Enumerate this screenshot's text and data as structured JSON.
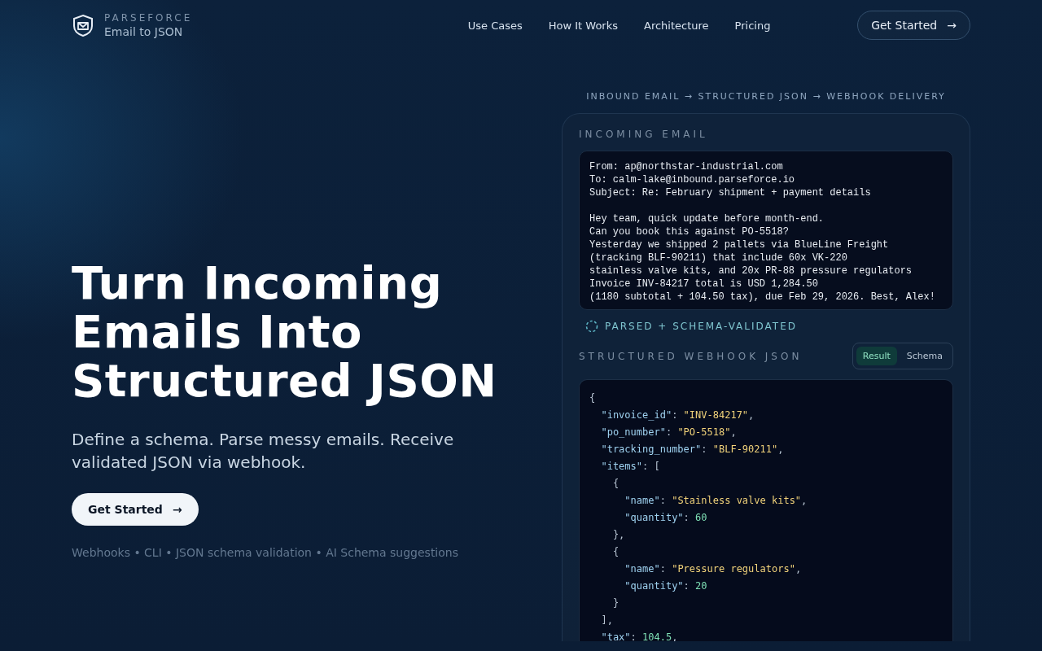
{
  "brand": {
    "name": "PARSEFORCE",
    "tagline": "Email to JSON"
  },
  "nav": [
    "Use Cases",
    "How It Works",
    "Architecture",
    "Pricing"
  ],
  "header_cta": {
    "label": "Get Started",
    "icon": "→"
  },
  "hero": {
    "title": "Turn Incoming Emails Into Structured JSON",
    "subtitle": "Define a schema. Parse messy emails. Receive validated JSON via webhook.",
    "cta": {
      "label": "Get Started",
      "icon": "→"
    },
    "features": "Webhooks • CLI • JSON schema validation • AI Schema suggestions"
  },
  "demo": {
    "caption": "INBOUND EMAIL → STRUCTURED JSON → WEBHOOK DELIVERY",
    "email_heading": "INCOMING EMAIL",
    "email_headers": [
      "From: ap@northstar-industrial.com",
      "To: calm-lake@inbound.parseforce.io",
      "Subject: Re: February shipment + payment details"
    ],
    "email_body": [
      "Hey team, quick update before month-end.",
      "Can you book this against PO-5518?",
      "Yesterday we shipped 2 pallets via BlueLine Freight",
      "(tracking BLF-90211) that include 60x VK-220",
      "stainless valve kits, and 20x PR-88 pressure regulators",
      "Invoice INV-84217 total is USD 1,284.50",
      "(1180 subtotal + 104.50 tax), due Feb 29, 2026. Best, Alex!"
    ],
    "status": "PARSED + SCHEMA-VALIDATED",
    "json_heading": "STRUCTURED WEBHOOK JSON",
    "tabs": [
      {
        "label": "Result",
        "selected": true
      },
      {
        "label": "Schema",
        "selected": false
      }
    ],
    "code_lines": [
      [
        {
          "kind": "punct",
          "text": "{"
        }
      ],
      [
        {
          "kind": "key",
          "text": "  \"invoice_id\""
        },
        {
          "kind": "punct",
          "text": ": "
        },
        {
          "kind": "string",
          "text": "\"INV-84217\""
        },
        {
          "kind": "punct",
          "text": ","
        }
      ],
      [
        {
          "kind": "key",
          "text": "  \"po_number\""
        },
        {
          "kind": "punct",
          "text": ": "
        },
        {
          "kind": "string",
          "text": "\"PO-5518\""
        },
        {
          "kind": "punct",
          "text": ","
        }
      ],
      [
        {
          "kind": "key",
          "text": "  \"tracking_number\""
        },
        {
          "kind": "punct",
          "text": ": "
        },
        {
          "kind": "string",
          "text": "\"BLF-90211\""
        },
        {
          "kind": "punct",
          "text": ","
        }
      ],
      [
        {
          "kind": "key",
          "text": "  \"items\""
        },
        {
          "kind": "punct",
          "text": ": ["
        }
      ],
      [
        {
          "kind": "punct",
          "text": "    {"
        }
      ],
      [
        {
          "kind": "key",
          "text": "      \"name\""
        },
        {
          "kind": "punct",
          "text": ": "
        },
        {
          "kind": "string",
          "text": "\"Stainless valve kits\""
        },
        {
          "kind": "punct",
          "text": ","
        }
      ],
      [
        {
          "kind": "key",
          "text": "      \"quantity\""
        },
        {
          "kind": "punct",
          "text": ": "
        },
        {
          "kind": "number",
          "text": "60"
        }
      ],
      [
        {
          "kind": "punct",
          "text": "    },"
        }
      ],
      [
        {
          "kind": "punct",
          "text": "    {"
        }
      ],
      [
        {
          "kind": "key",
          "text": "      \"name\""
        },
        {
          "kind": "punct",
          "text": ": "
        },
        {
          "kind": "string",
          "text": "\"Pressure regulators\""
        },
        {
          "kind": "punct",
          "text": ","
        }
      ],
      [
        {
          "kind": "key",
          "text": "      \"quantity\""
        },
        {
          "kind": "punct",
          "text": ": "
        },
        {
          "kind": "number",
          "text": "20"
        }
      ],
      [
        {
          "kind": "punct",
          "text": "    }"
        }
      ],
      [
        {
          "kind": "punct",
          "text": "  ],"
        }
      ],
      [
        {
          "kind": "key",
          "text": "  \"tax\""
        },
        {
          "kind": "punct",
          "text": ": "
        },
        {
          "kind": "number",
          "text": "104.5"
        },
        {
          "kind": "punct",
          "text": ","
        }
      ]
    ]
  }
}
